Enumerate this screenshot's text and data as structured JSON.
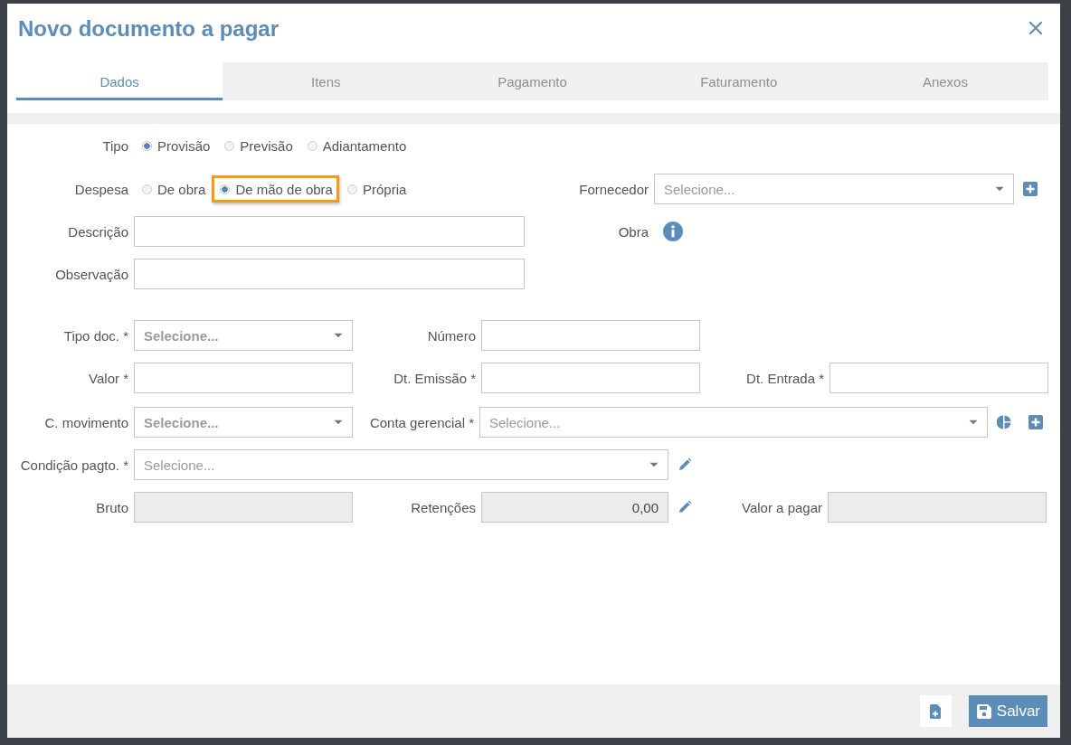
{
  "dialog": {
    "title": "Novo documento a pagar"
  },
  "tabs": [
    {
      "label": "Dados",
      "selected": true
    },
    {
      "label": "Itens",
      "selected": false
    },
    {
      "label": "Pagamento",
      "selected": false
    },
    {
      "label": "Faturamento",
      "selected": false
    },
    {
      "label": "Anexos",
      "selected": false
    }
  ],
  "form": {
    "tipo": {
      "label": "Tipo",
      "options": [
        {
          "label": "Provisão",
          "selected": true,
          "highlighted": false
        },
        {
          "label": "Previsão",
          "selected": false,
          "highlighted": false
        },
        {
          "label": "Adiantamento",
          "selected": false,
          "highlighted": false
        }
      ]
    },
    "despesa": {
      "label": "Despesa",
      "options": [
        {
          "label": "De obra",
          "selected": false,
          "highlighted": false
        },
        {
          "label": "De mão de obra",
          "selected": true,
          "highlighted": true
        },
        {
          "label": "Própria",
          "selected": false,
          "highlighted": false
        }
      ]
    },
    "fornecedor": {
      "label": "Fornecedor",
      "placeholder": "Selecione..."
    },
    "descricao": {
      "label": "Descrição"
    },
    "obra": {
      "label": "Obra"
    },
    "observacao": {
      "label": "Observação"
    },
    "tipo_doc": {
      "label": "Tipo doc. *",
      "placeholder": "Selecione..."
    },
    "numero": {
      "label": "Número"
    },
    "valor": {
      "label": "Valor *"
    },
    "dt_emissao": {
      "label": "Dt. Emissão *"
    },
    "dt_entrada": {
      "label": "Dt. Entrada *"
    },
    "c_movimento": {
      "label": "C. movimento",
      "placeholder": "Selecione..."
    },
    "conta_gerencial": {
      "label": "Conta gerencial *",
      "placeholder": "Selecione..."
    },
    "condicao_pagto": {
      "label": "Condição pagto. *",
      "placeholder": "Selecione..."
    },
    "bruto": {
      "label": "Bruto",
      "disabled": true
    },
    "retencoes": {
      "label": "Retenções",
      "value": "0,00",
      "disabled": true
    },
    "valor_a_pagar": {
      "label": "Valor a pagar",
      "disabled": true
    }
  },
  "footer": {
    "save_button": "Salvar"
  }
}
